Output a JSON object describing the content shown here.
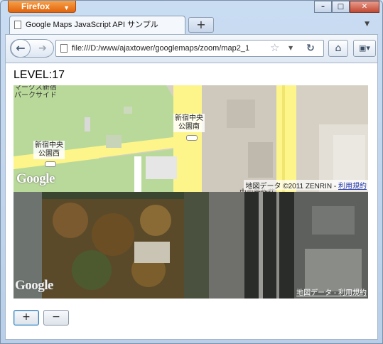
{
  "browser": {
    "menu_label": "Firefox",
    "tab_title": "Google Maps JavaScript API サンプル",
    "new_tab_label": "+",
    "url": "file:///D:/www/ajaxtower/googlemaps/zoom/map2_1"
  },
  "page": {
    "level_text": "LEVEL:17",
    "zoom_in_label": "+",
    "zoom_out_label": "−"
  },
  "map_roadmap": {
    "logo": "Google",
    "labels": {
      "top_left": "マークス新宿\nパークサイド",
      "poi_south": "新宿中央\n公園南",
      "poi_west": "新宿中央\n公園西",
      "overlap": "中央新作荘"
    },
    "copyright_text": "地図データ ©2011 ZENRIN - ",
    "terms_link": "利用規約"
  },
  "map_satellite": {
    "logo": "Google",
    "copyright_text": "地図データ - ",
    "terms_link": "利用規約"
  },
  "colors": {
    "park_green": "#b9d99a",
    "road_yellow": "#fdf58a",
    "block_gray": "#d6d0c4"
  }
}
